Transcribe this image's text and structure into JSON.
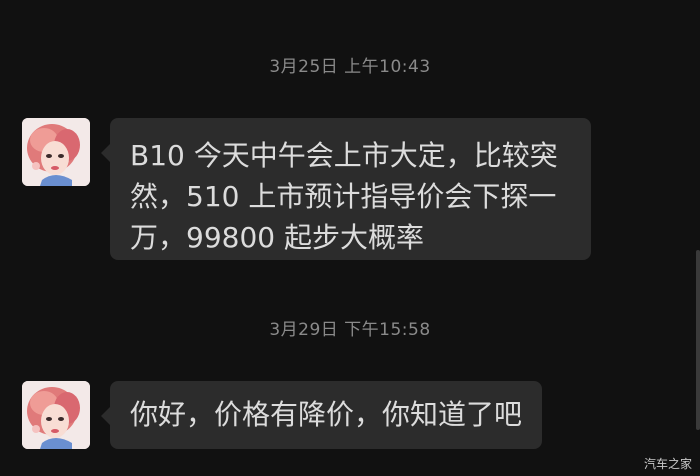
{
  "chat": {
    "messages": [
      {
        "timestamp": "3月25日 上午10:43",
        "lines": [
          "B10 今天中午会上市大定，比较突",
          "然，510 上市预计指导价会下探一",
          "万，99800 起步大概率"
        ]
      },
      {
        "timestamp": "3月29日 下午15:58",
        "lines": [
          "你好，价格有降价，你知道了吧"
        ]
      }
    ]
  },
  "watermark": "汽车之家",
  "colors": {
    "background": "#111111",
    "bubble": "#2c2c2c",
    "text": "#dcdcdc",
    "timestamp": "#8a8a8a"
  },
  "icons": {
    "avatar": "avatar-illustration-girl"
  }
}
